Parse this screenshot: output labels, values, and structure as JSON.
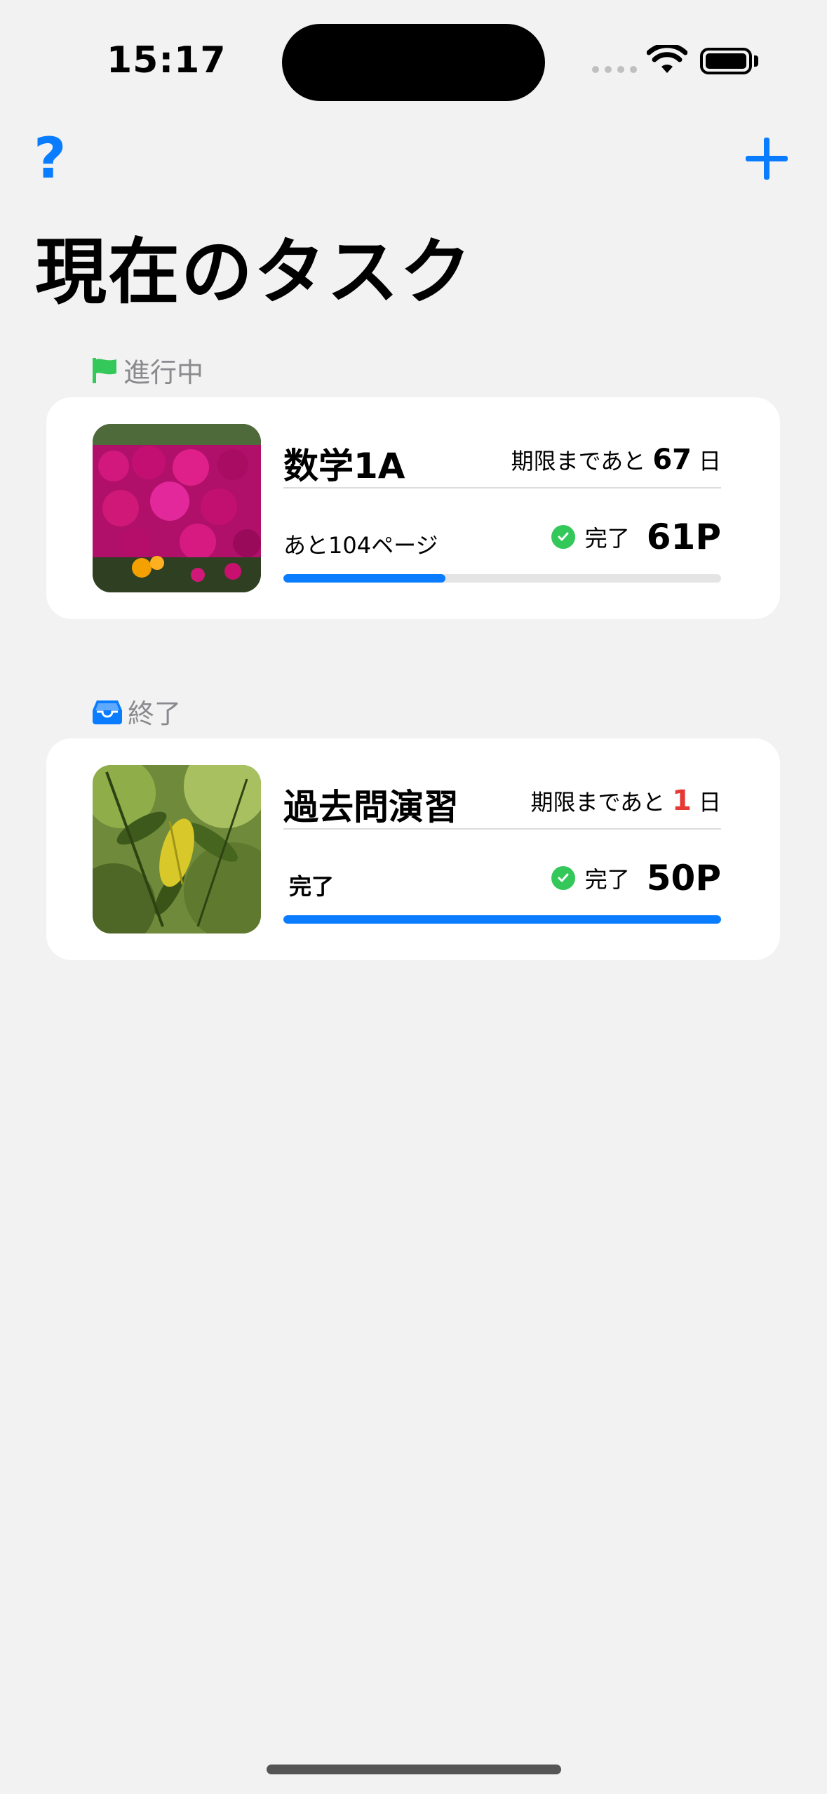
{
  "status_bar": {
    "time": "15:17"
  },
  "nav": {
    "help_label": "?"
  },
  "page_title": "現在のタスク",
  "sections": [
    {
      "header": "進行中",
      "header_icon": "flag-icon",
      "header_icon_color": "#34c759",
      "tasks": [
        {
          "title": "数学1A",
          "deadline_prefix": "期限まであと",
          "deadline_days": "67",
          "deadline_unit": "日",
          "status_text": "あと104ページ",
          "done_label": "完了",
          "pages": "61P",
          "progress_fraction": 0.37
        }
      ]
    },
    {
      "header": "終了",
      "header_icon": "tray-icon",
      "header_icon_color": "#0a7cff",
      "tasks": [
        {
          "title": "過去問演習",
          "deadline_prefix": "期限まであと",
          "deadline_days": "1",
          "deadline_unit": "日",
          "status_text": "完了",
          "done_label": "完了",
          "pages": "50P",
          "progress_fraction": 1.0
        }
      ]
    }
  ],
  "colors": {
    "accent": "#0a7cff",
    "success": "#34c759",
    "urgent": "#e53935"
  }
}
